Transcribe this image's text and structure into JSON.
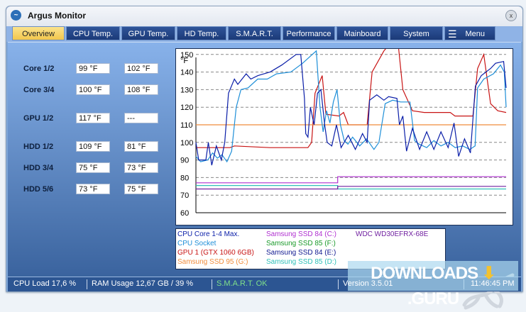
{
  "window": {
    "title": "Argus Monitor",
    "close": "x"
  },
  "tabs": [
    {
      "label": "Overview",
      "active": true
    },
    {
      "label": "CPU Temp."
    },
    {
      "label": "GPU Temp."
    },
    {
      "label": "HD Temp."
    },
    {
      "label": "S.M.A.R.T."
    },
    {
      "label": "Performance"
    },
    {
      "label": "Mainboard"
    },
    {
      "label": "System"
    },
    {
      "label": "Menu"
    }
  ],
  "sensors": [
    {
      "label": "Core 1/2",
      "v1": "99 °F",
      "v2": "102 °F"
    },
    {
      "label": "Core 3/4",
      "v1": "100 °F",
      "v2": "108 °F"
    },
    {
      "label": "GPU 1/2",
      "v1": "117 °F",
      "v2": "---"
    },
    {
      "label": "HDD 1/2",
      "v1": "109 °F",
      "v2": "81 °F"
    },
    {
      "label": "HDD 3/4",
      "v1": "75 °F",
      "v2": "73 °F"
    },
    {
      "label": "HDD 5/6",
      "v1": "73 °F",
      "v2": "75 °F"
    }
  ],
  "legend": [
    {
      "name": "CPU Core 1-4 Max.",
      "color": "#0a1ea8"
    },
    {
      "name": "CPU Socket",
      "color": "#1e8fd8"
    },
    {
      "name": "GPU 1 (GTX 1060 6GB)",
      "color": "#c81414"
    },
    {
      "name": "Samsung SSD 95 (G:)",
      "color": "#f08c3c"
    },
    {
      "name": "Samsung SSD 84 (C:)",
      "color": "#b030d0"
    },
    {
      "name": "Samsung SSD 85 (F:)",
      "color": "#1a9a2a"
    },
    {
      "name": "Samsung SSD 84 (E:)",
      "color": "#101890"
    },
    {
      "name": "Samsung SSD 85 (D:)",
      "color": "#30c0b8"
    },
    {
      "name": "WDC WD30EFRX-68E",
      "color": "#7020a0"
    }
  ],
  "status": {
    "cpu_load": "CPU Load 17,6 %",
    "ram": "RAM Usage 12,67 GB / 39 %",
    "smart": "S.M.A.R.T. OK",
    "version": "Version 3.5.01",
    "time": "11:46:45 PM"
  },
  "watermark": "DOWNLOADS GURU",
  "chart_data": {
    "type": "line",
    "ylabel": "°F",
    "ylim": [
      60,
      160
    ],
    "xlim": [
      0,
      100
    ],
    "yticks": [
      60,
      70,
      80,
      90,
      100,
      110,
      120,
      130,
      140,
      150
    ],
    "series": [
      {
        "name": "GPU 1 (GTX 1060 6GB)",
        "color": "#c81414",
        "points": [
          [
            0,
            97
          ],
          [
            11,
            97
          ],
          [
            12.4,
            98
          ],
          [
            23.9,
            97
          ],
          [
            36,
            97
          ],
          [
            36.1,
            97
          ],
          [
            37.3,
            100
          ],
          [
            38.4,
            128
          ],
          [
            40.7,
            138
          ],
          [
            41.9,
            116
          ],
          [
            46.1,
            115
          ],
          [
            47.6,
            117
          ],
          [
            49.1,
            110
          ],
          [
            55.2,
            110
          ],
          [
            56.8,
            140
          ],
          [
            60.6,
            152
          ],
          [
            62.5,
            156
          ],
          [
            65.2,
            156
          ],
          [
            66.7,
            130
          ],
          [
            69.8,
            118
          ],
          [
            73.6,
            117
          ],
          [
            82,
            117
          ],
          [
            83.5,
            115
          ],
          [
            89.3,
            115
          ],
          [
            90.8,
            142
          ],
          [
            92.8,
            150
          ],
          [
            95,
            122
          ],
          [
            97.3,
            118
          ],
          [
            100,
            117
          ]
        ]
      },
      {
        "name": "Samsung SSD 95 (G:)",
        "color": "#f08c3c",
        "points": [
          [
            0,
            110
          ],
          [
            100,
            110
          ]
        ]
      },
      {
        "name": "Samsung SSD 84 (C:)",
        "color": "#b030d0",
        "points": [
          [
            0,
            77
          ],
          [
            45.7,
            77
          ],
          [
            45.7,
            80.5
          ],
          [
            100,
            80.5
          ]
        ]
      },
      {
        "name": "Samsung SSD 85 (D:)",
        "color": "#30c0b8",
        "points": [
          [
            0,
            75.5
          ],
          [
            45.7,
            75.5
          ],
          [
            45.7,
            73.5
          ],
          [
            100,
            73.5
          ]
        ]
      },
      {
        "name": "WDC WD30EFRX-68E",
        "color": "#7020a0",
        "points": [
          [
            0,
            73.5
          ],
          [
            45.7,
            73.5
          ],
          [
            45.7,
            75
          ],
          [
            100,
            75
          ]
        ]
      },
      {
        "name": "CPU Socket",
        "color": "#1e8fd8",
        "points": [
          [
            0,
            92
          ],
          [
            1.5,
            89
          ],
          [
            3.8,
            90
          ],
          [
            5.4,
            94
          ],
          [
            6.9,
            91
          ],
          [
            8.4,
            93
          ],
          [
            10,
            89
          ],
          [
            11.5,
            95
          ],
          [
            13,
            120
          ],
          [
            14.5,
            130
          ],
          [
            16.8,
            131
          ],
          [
            19.9,
            136
          ],
          [
            23,
            136
          ],
          [
            26,
            139
          ],
          [
            30.6,
            140
          ],
          [
            34.4,
            145
          ],
          [
            37.5,
            150
          ],
          [
            38.8,
            152
          ],
          [
            40,
            120
          ],
          [
            41,
            106
          ],
          [
            42.1,
            118
          ],
          [
            43.2,
            111
          ],
          [
            44.3,
            123
          ],
          [
            45.5,
            130
          ],
          [
            46.6,
            110
          ],
          [
            47.8,
            101
          ],
          [
            49,
            99
          ],
          [
            50.5,
            103
          ],
          [
            52.8,
            98
          ],
          [
            55,
            102
          ],
          [
            57.4,
            96
          ],
          [
            59,
            100
          ],
          [
            61,
            122
          ],
          [
            63.4,
            124
          ],
          [
            66,
            123
          ],
          [
            69,
            123
          ],
          [
            70.5,
            101
          ],
          [
            72,
            99
          ],
          [
            74.4,
            97
          ],
          [
            76.7,
            101
          ],
          [
            79,
            98
          ],
          [
            81.3,
            100
          ],
          [
            83.6,
            97
          ],
          [
            86,
            98
          ],
          [
            88.3,
            96
          ],
          [
            90,
            98
          ],
          [
            90.8,
            131
          ],
          [
            92.8,
            136
          ],
          [
            95.9,
            139
          ],
          [
            98.2,
            144
          ],
          [
            99.4,
            140
          ],
          [
            100,
            120
          ]
        ]
      },
      {
        "name": "CPU Core 1-4 Max.",
        "color": "#0a1ea8",
        "points": [
          [
            0,
            100
          ],
          [
            0.9,
            90
          ],
          [
            3.2,
            90
          ],
          [
            4,
            100
          ],
          [
            5.1,
            87
          ],
          [
            6.6,
            98
          ],
          [
            8.2,
            90
          ],
          [
            9.3,
            100
          ],
          [
            10.5,
            128
          ],
          [
            12.4,
            136
          ],
          [
            13.5,
            133
          ],
          [
            16.2,
            139
          ],
          [
            17.7,
            136
          ],
          [
            20,
            138
          ],
          [
            23.9,
            140
          ],
          [
            27.7,
            144
          ],
          [
            32.3,
            150
          ],
          [
            33.8,
            150
          ],
          [
            35,
            125
          ],
          [
            35.4,
            105
          ],
          [
            36.1,
            103
          ],
          [
            36.9,
            120
          ],
          [
            38.1,
            110
          ],
          [
            39.2,
            128
          ],
          [
            40.3,
            130
          ],
          [
            41.5,
            110
          ],
          [
            42.3,
            100
          ],
          [
            43.8,
            98
          ],
          [
            45.3,
            110
          ],
          [
            46.8,
            97
          ],
          [
            49.1,
            104
          ],
          [
            51.4,
            96
          ],
          [
            53.7,
            105
          ],
          [
            55.2,
            100
          ],
          [
            56,
            124
          ],
          [
            58.3,
            127
          ],
          [
            60.6,
            124
          ],
          [
            62.1,
            126
          ],
          [
            64.8,
            125
          ],
          [
            65.6,
            110
          ],
          [
            66.7,
            115
          ],
          [
            67.9,
            95
          ],
          [
            69.8,
            108
          ],
          [
            72.1,
            96
          ],
          [
            74.4,
            106
          ],
          [
            76.7,
            96
          ],
          [
            79,
            106
          ],
          [
            81.3,
            97
          ],
          [
            83.2,
            111
          ],
          [
            84.7,
            92
          ],
          [
            86.6,
            102
          ],
          [
            88.5,
            94
          ],
          [
            90.1,
            132
          ],
          [
            92,
            138
          ],
          [
            95,
            142
          ],
          [
            96.6,
            145
          ],
          [
            99.2,
            146
          ],
          [
            100,
            131
          ]
        ]
      }
    ]
  }
}
